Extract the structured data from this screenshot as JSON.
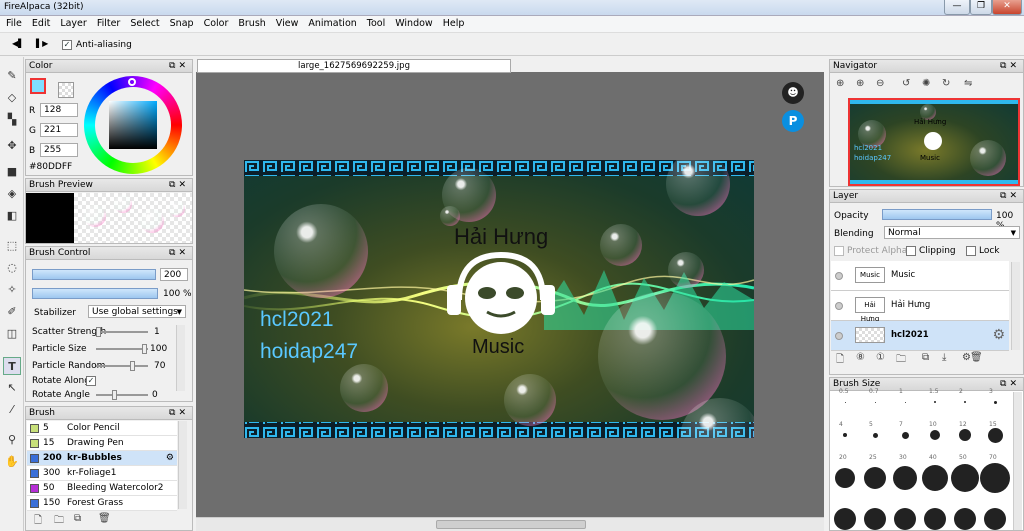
{
  "window": {
    "title": "FireAlpaca (32bit)",
    "minimize": "—",
    "maximize": "❐",
    "close": "✕"
  },
  "menu": [
    "File",
    "Edit",
    "Layer",
    "Filter",
    "Select",
    "Snap",
    "Color",
    "Brush",
    "View",
    "Animation",
    "Tool",
    "Window",
    "Help"
  ],
  "toolbar": {
    "prev": "◀▌",
    "next": "▌▶",
    "antialias_label": "Anti-aliasing",
    "antialias_checked": true
  },
  "color_panel": {
    "title": "Color",
    "r_label": "R",
    "r": "128",
    "g_label": "G",
    "g": "221",
    "b_label": "B",
    "b": "255",
    "hex": "#80DDFF",
    "fg_color": "#80DDFF"
  },
  "brush_preview": {
    "title": "Brush Preview"
  },
  "brush_control": {
    "title": "Brush Control",
    "size": "200",
    "opacity": "100 %",
    "stabilizer_label": "Stabilizer",
    "stabilizer_value": "Use global settings",
    "scatter_label": "Scatter Strength",
    "scatter_value": "1",
    "particle_size_label": "Particle Size",
    "particle_size_value": "100",
    "particle_random_label": "Particle Random",
    "particle_random_value": "70",
    "rotate_along_label": "Rotate Along",
    "rotate_angle_label": "Rotate Angle",
    "rotate_angle_value": "0"
  },
  "brush_panel": {
    "title": "Brush",
    "items": [
      {
        "size": "5",
        "name": "Color Pencil",
        "color": "#c8e07a"
      },
      {
        "size": "15",
        "name": "Drawing Pen",
        "color": "#c8e07a"
      },
      {
        "size": "200",
        "name": "kr-Bubbles",
        "color": "#3a6fd8"
      },
      {
        "size": "300",
        "name": "kr-Foliage1",
        "color": "#3a6fd8"
      },
      {
        "size": "50",
        "name": "Bleeding Watercolor2",
        "color": "#b62fd6"
      },
      {
        "size": "150",
        "name": "Forest Grass",
        "color": "#3a6fd8"
      }
    ]
  },
  "document": {
    "tab": "large_1627569692259.jpg",
    "art_title": "Hải Hưng",
    "art_subtitle": "Music",
    "art_text1": "hcl2021",
    "art_text2": "hoidap247"
  },
  "navigator": {
    "title": "Navigator",
    "thumb_text1": "Hải Hưng",
    "thumb_text2": "Music",
    "thumb_text3": "hcl2021",
    "thumb_text4": "hoidap247"
  },
  "layer_panel": {
    "title": "Layer",
    "opacity_label": "Opacity",
    "opacity_value": "100 %",
    "blending_label": "Blending",
    "blending_value": "Normal",
    "protect_alpha": "Protect Alpha",
    "clipping": "Clipping",
    "lock": "Lock",
    "layers": [
      {
        "name": "Music",
        "thumb": "Music"
      },
      {
        "name": "Hải Hưng",
        "thumb": "Hải Hưng"
      },
      {
        "name": "hcl2021",
        "thumb": ""
      }
    ]
  },
  "brush_size": {
    "title": "Brush Size",
    "row1": [
      "0.5",
      "0.7",
      "1",
      "1.5",
      "2",
      "3"
    ],
    "row2": [
      "4",
      "5",
      "7",
      "10",
      "12",
      "15"
    ],
    "row3": [
      "20",
      "25",
      "30",
      "40",
      "50",
      "70"
    ]
  }
}
